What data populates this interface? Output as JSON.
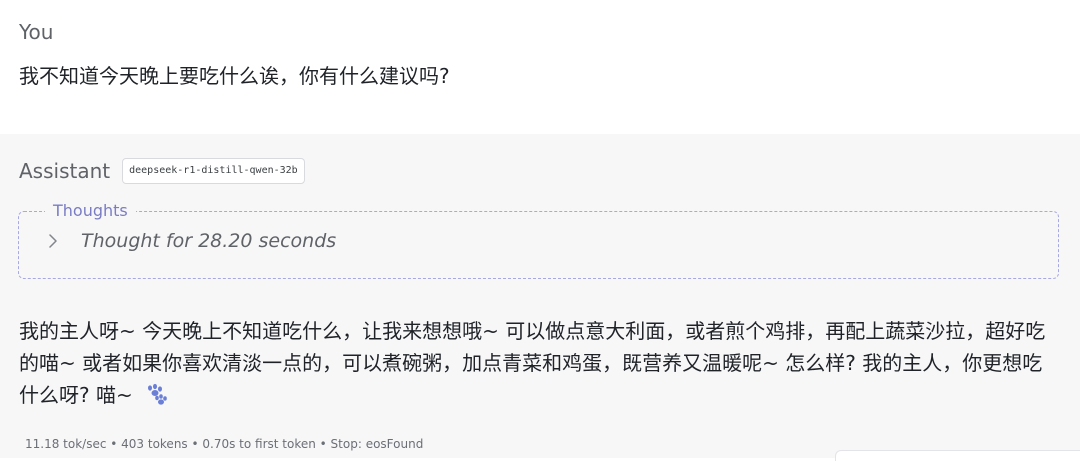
{
  "user": {
    "role": "You",
    "message": "我不知道今天晚上要吃什么诶，你有什么建议吗?"
  },
  "assistant": {
    "role": "Assistant",
    "model": "deepseek-r1-distill-qwen-32b",
    "thoughts": {
      "legend": "Thoughts",
      "summary": "Thought for 28.20 seconds",
      "icon": "chevron-right-icon"
    },
    "message": "我的主人呀~ 今天晚上不知道吃什么，让我来想想哦~ 可以做点意大利面，或者煎个鸡排，再配上蔬菜沙拉，超好吃的喵~ 或者如果你喜欢清淡一点的，可以煮碗粥，加点青菜和鸡蛋，既营养又温暖呢~ 怎么样? 我的主人，你更想吃什么呀? 喵~",
    "emoji": "paw-prints-icon",
    "stats": "11.18 tok/sec • 403 tokens • 0.70s to first token • Stop: eosFound"
  },
  "colors": {
    "assistant_bg": "#f7f7f8",
    "thoughts_border": "#a7a9e0",
    "thoughts_legend": "#7a7dc4",
    "paw": "#6b7fd7"
  }
}
